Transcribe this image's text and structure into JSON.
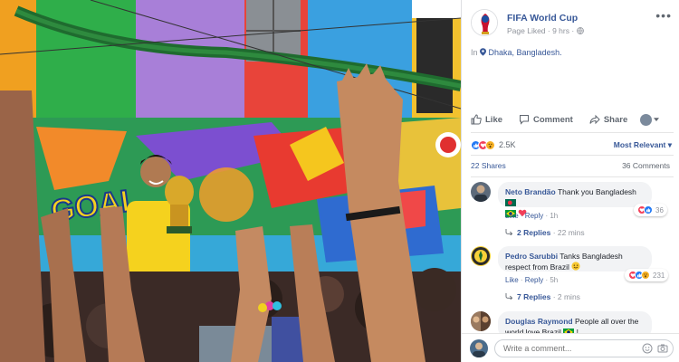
{
  "post": {
    "page_name": "FIFA World Cup",
    "meta": "Page Liked · 9 hrs · ",
    "location_prefix": "In ",
    "location": "Dhaka, Bangladesh.",
    "more_label": "•••"
  },
  "actions": {
    "like": "Like",
    "comment": "Comment",
    "share": "Share"
  },
  "reactions": {
    "count": "2.5K",
    "sort_label": "Most Relevant ▾",
    "shares": "22 Shares",
    "comments": "36 Comments"
  },
  "comments": [
    {
      "author": "Neto Brandão",
      "text": " Thank you Bangladesh ",
      "like": "Like",
      "reply": "Reply",
      "time": "1h",
      "reaction_count": "36",
      "replies": "2 Replies",
      "replies_time": "22 mins"
    },
    {
      "author": "Pedro Sarubbi",
      "text": " Tanks Bangladesh respect from Brazil ",
      "like": "Like",
      "reply": "Reply",
      "time": "5h",
      "reaction_count": "231",
      "replies": "7 Replies",
      "replies_time": "2 mins"
    },
    {
      "author": "Douglas Raymond",
      "text": " People all over the world love Brazil "
    }
  ],
  "composer": {
    "placeholder": "Write a comment..."
  },
  "photo": {
    "wall_text": "GOAL"
  },
  "colors": {
    "link": "#385898",
    "like_blue": "#2078f4",
    "love_red": "#f33e58",
    "wow_yellow": "#f7b125",
    "bubble": "#f2f3f5"
  }
}
